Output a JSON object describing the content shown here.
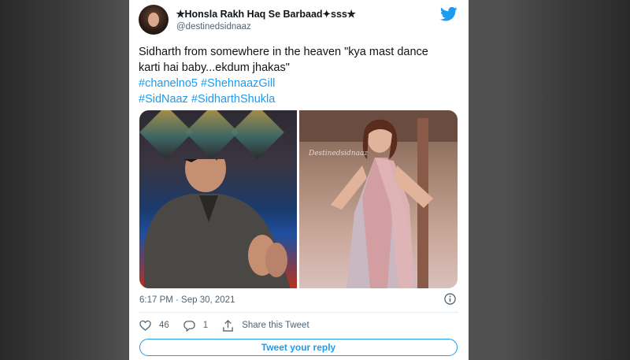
{
  "tweet": {
    "display_name": "✯Honsla Rakh Haq Se Barbaad✦sss✯",
    "handle": "@destinedsidnaaz",
    "text_line1": "Sidharth from somewhere in the heaven \"kya mast dance",
    "text_line2": "karti hai baby...ekdum jhakas\"",
    "hashtags_line1": [
      "#chanelno5",
      "#ShehnaazGill"
    ],
    "hashtags_line2": [
      "#SidNaaz",
      "#SidharthShukla"
    ],
    "timestamp": "6:17 PM · Sep 30, 2021",
    "like_count": "46",
    "reply_count": "1",
    "share_label": "Share this Tweet",
    "reply_button_label": "Tweet your reply",
    "watermark": "Destinedsidnaaz"
  },
  "colors": {
    "accent": "#1d9bf0",
    "text": "#0f1419",
    "secondary": "#536471"
  },
  "icons": [
    "twitter-icon",
    "info-icon",
    "heart-icon",
    "reply-icon",
    "share-icon"
  ]
}
